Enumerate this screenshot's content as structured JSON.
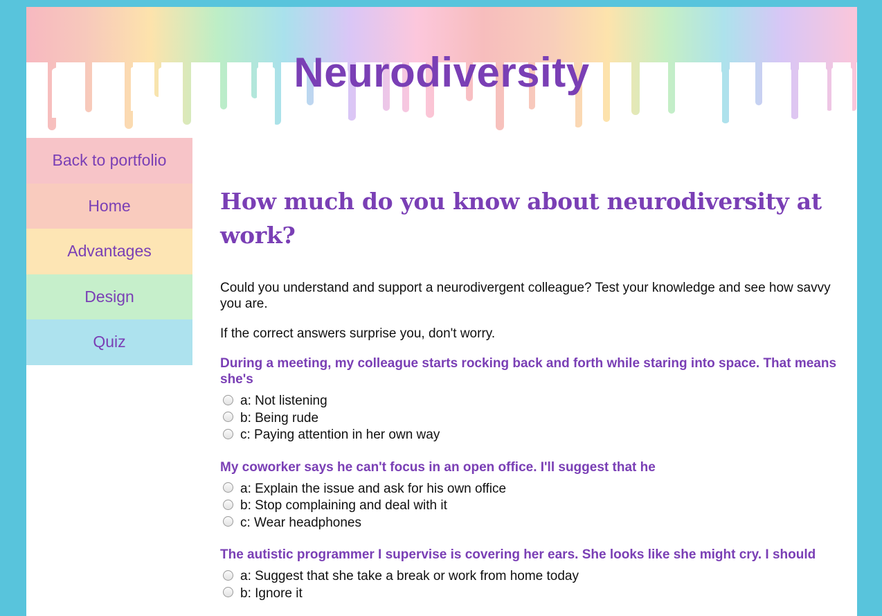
{
  "site": {
    "title": "Neurodiversity"
  },
  "nav": {
    "items": [
      {
        "label": "Back to portfolio",
        "color": "#f7c4c8"
      },
      {
        "label": "Home",
        "color": "#f9cbbe"
      },
      {
        "label": "Advantages",
        "color": "#fde5b4"
      },
      {
        "label": "Design",
        "color": "#c6efcb"
      },
      {
        "label": "Quiz",
        "color": "#ade2ee"
      }
    ]
  },
  "main": {
    "heading": "How much do you know about neurodiversity at work?",
    "intro1": "Could you understand and support a neurodivergent colleague? Test your knowledge and see how savvy you are.",
    "intro2": "If the correct answers surprise you, don't worry.",
    "questions": [
      {
        "text": "During a meeting, my colleague starts rocking back and forth while staring into space. That means she's",
        "options": [
          "a: Not listening",
          "b: Being rude",
          "c: Paying attention in her own way"
        ]
      },
      {
        "text": "My coworker says he can't focus in an open office. I'll suggest that he",
        "options": [
          "a: Explain the issue and ask for his own office",
          "b: Stop complaining and deal with it",
          "c: Wear headphones"
        ]
      },
      {
        "text": "The autistic programmer I supervise is covering her ears. She looks like she might cry. I should",
        "options": [
          "a: Suggest that she take a break or work from home today",
          "b: Ignore it"
        ]
      }
    ]
  },
  "colors": {
    "background": "#58c4dc",
    "accent": "#7a3fb5",
    "rainbow": [
      "#f7b8c0",
      "#fddfa8",
      "#b8ecc4",
      "#a8e0ec",
      "#dcc4f6",
      "#fcc6dc"
    ]
  }
}
